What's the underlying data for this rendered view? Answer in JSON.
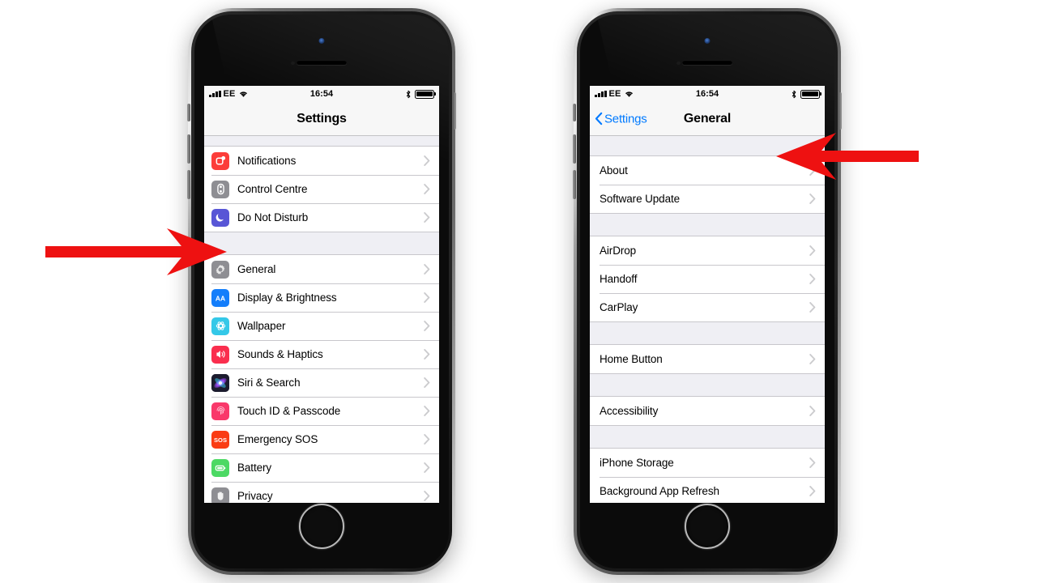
{
  "status_bar": {
    "carrier": "EE",
    "time": "16:54",
    "signal_icon": "signal-bars-icon",
    "wifi_icon": "wifi-icon",
    "bluetooth_icon": "bluetooth-icon",
    "battery_icon": "battery-full-icon",
    "battery_level": 100
  },
  "colors": {
    "accent_blue": "#007aff",
    "arrow_red": "#ee1111",
    "list_background": "#efeff4",
    "separator": "#c8c7cc",
    "navbar_background": "#f7f7f7"
  },
  "phones": [
    {
      "name": "settings-phone",
      "screen": {
        "navbar": {
          "title": "Settings",
          "back_label": null
        },
        "groups": [
          {
            "rows": [
              {
                "label": "Notifications",
                "icon": "notifications-icon",
                "icon_color": "#fc3d39",
                "chevron": true
              },
              {
                "label": "Control Centre",
                "icon": "control-centre-icon",
                "icon_color": "#8e8e93",
                "chevron": true
              },
              {
                "label": "Do Not Disturb",
                "icon": "do-not-disturb-icon",
                "icon_color": "#5856d6",
                "chevron": true
              }
            ]
          },
          {
            "rows": [
              {
                "label": "General",
                "icon": "general-gear-icon",
                "icon_color": "#8e8e93",
                "chevron": true
              },
              {
                "label": "Display & Brightness",
                "icon": "display-brightness-icon",
                "icon_color": "#147efb",
                "chevron": true
              },
              {
                "label": "Wallpaper",
                "icon": "wallpaper-icon",
                "icon_color": "#34c8e8",
                "chevron": true
              },
              {
                "label": "Sounds & Haptics",
                "icon": "sounds-haptics-icon",
                "icon_color": "#fa2e4e",
                "chevron": true
              },
              {
                "label": "Siri & Search",
                "icon": "siri-search-icon",
                "icon_color": "#1c1c2e",
                "chevron": true
              },
              {
                "label": "Touch ID & Passcode",
                "icon": "touch-id-passcode-icon",
                "icon_color": "#f9386a",
                "chevron": true
              },
              {
                "label": "Emergency SOS",
                "icon": "emergency-sos-icon",
                "icon_color": "#fa3c14",
                "chevron": true
              },
              {
                "label": "Battery",
                "icon": "battery-settings-icon",
                "icon_color": "#4cd964",
                "chevron": true
              },
              {
                "label": "Privacy",
                "icon": "privacy-hand-icon",
                "icon_color": "#8e8e93",
                "chevron": true
              }
            ]
          }
        ]
      }
    },
    {
      "name": "general-phone",
      "screen": {
        "navbar": {
          "title": "General",
          "back_label": "Settings"
        },
        "groups": [
          {
            "rows": [
              {
                "label": "About",
                "icon": null,
                "chevron": true
              },
              {
                "label": "Software Update",
                "icon": null,
                "chevron": true
              }
            ]
          },
          {
            "rows": [
              {
                "label": "AirDrop",
                "icon": null,
                "chevron": true
              },
              {
                "label": "Handoff",
                "icon": null,
                "chevron": true
              },
              {
                "label": "CarPlay",
                "icon": null,
                "chevron": true
              }
            ]
          },
          {
            "rows": [
              {
                "label": "Home Button",
                "icon": null,
                "chevron": true
              }
            ]
          },
          {
            "rows": [
              {
                "label": "Accessibility",
                "icon": null,
                "chevron": true
              }
            ]
          },
          {
            "rows": [
              {
                "label": "iPhone Storage",
                "icon": null,
                "chevron": true
              },
              {
                "label": "Background App Refresh",
                "icon": null,
                "chevron": true
              }
            ]
          }
        ]
      }
    }
  ],
  "annotations": [
    {
      "name": "arrow-pointing-to-general",
      "direction": "right",
      "color": "#ee1111",
      "points_at": "General"
    },
    {
      "name": "arrow-pointing-to-about",
      "direction": "left",
      "color": "#ee1111",
      "points_at": "About"
    }
  ]
}
